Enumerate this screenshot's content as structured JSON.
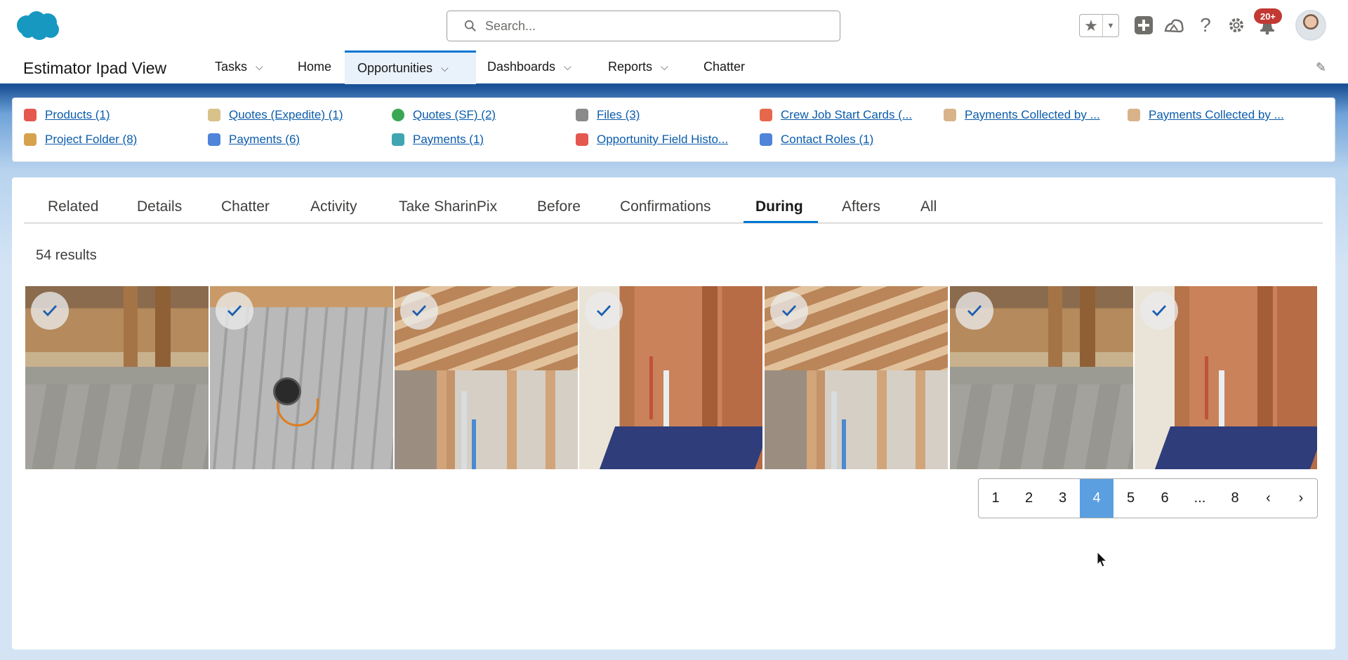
{
  "header": {
    "search_placeholder": "Search...",
    "notification_badge": "20+"
  },
  "nav": {
    "app_name": "Estimator Ipad View",
    "items": [
      {
        "label": "Tasks",
        "has_menu": true
      },
      {
        "label": "Home",
        "has_menu": false
      },
      {
        "label": "Opportunities",
        "has_menu": true,
        "active": true
      },
      {
        "label": "Dashboards",
        "has_menu": true
      },
      {
        "label": "Reports",
        "has_menu": true
      },
      {
        "label": "Chatter",
        "has_menu": false
      }
    ]
  },
  "related_links": [
    {
      "label": "Products (1)",
      "color": "#e5584f"
    },
    {
      "label": "Quotes (Expedite) (1)",
      "color": "#d9c18a"
    },
    {
      "label": "Quotes (SF) (2)",
      "color": "#3ba755"
    },
    {
      "label": "Files (3)",
      "color": "#8a8a8a"
    },
    {
      "label": "Crew Job Start Cards (...",
      "color": "#e5684c"
    },
    {
      "label": "Payments Collected by ...",
      "color": "#d8b38a"
    },
    {
      "label": "Payments Collected by ...",
      "color": "#d8b38a"
    },
    {
      "label": "Project Folder (8)",
      "color": "#d7a24e"
    },
    {
      "label": "Payments (6)",
      "color": "#4f84d8"
    },
    {
      "label": "Payments (1)",
      "color": "#3fa6b1"
    },
    {
      "label": "Opportunity Field Histo...",
      "color": "#e5584f"
    },
    {
      "label": "Contact Roles (1)",
      "color": "#4f84d8"
    }
  ],
  "tabs": [
    "Related",
    "Details",
    "Chatter",
    "Activity",
    "Take SharinPix",
    "Before",
    "Confirmations",
    "During",
    "Afters",
    "All"
  ],
  "active_tab": "During",
  "results_text": "54 results",
  "photos": [
    {
      "name": "photo-1",
      "style": "a"
    },
    {
      "name": "photo-2",
      "style": "b"
    },
    {
      "name": "photo-3",
      "style": "c"
    },
    {
      "name": "photo-4",
      "style": "d"
    },
    {
      "name": "photo-5",
      "style": "c"
    },
    {
      "name": "photo-6",
      "style": "a"
    },
    {
      "name": "photo-7",
      "style": "d"
    }
  ],
  "pagination": {
    "pages": [
      "1",
      "2",
      "3",
      "4",
      "5",
      "6",
      "...",
      "8"
    ],
    "current": "4",
    "prev": "‹",
    "next": "›"
  },
  "colors": {
    "brand_blue": "#1b5297",
    "link": "#0b5cab",
    "active_page": "#5b9fe0",
    "tab_underline": "#0176d3",
    "badge": "#c23934"
  }
}
